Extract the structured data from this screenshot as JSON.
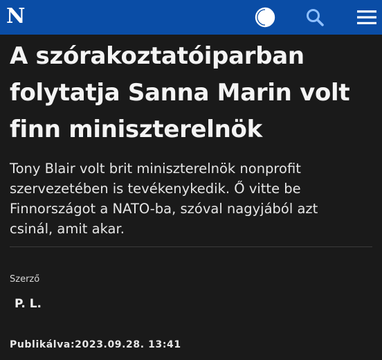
{
  "header": {
    "logo": "N",
    "bar_color": "#0a4da6",
    "icons": [
      "contrast-icon",
      "search-icon",
      "menu-icon"
    ]
  },
  "article": {
    "title": "A szórakoztatóiparban folytatja Sanna Marin volt finn miniszterelnök",
    "lead": "Tony Blair volt brit miniszterelnök nonprofit szervezetében is tevékenykedik. Ő vitte be Finnországot a NATO-ba, szóval nagyjából azt csinál, amit akar.",
    "author_label": "Szerző",
    "author_name": "P. L.",
    "published": "Publikálva:2023.09.28. 13:41"
  }
}
